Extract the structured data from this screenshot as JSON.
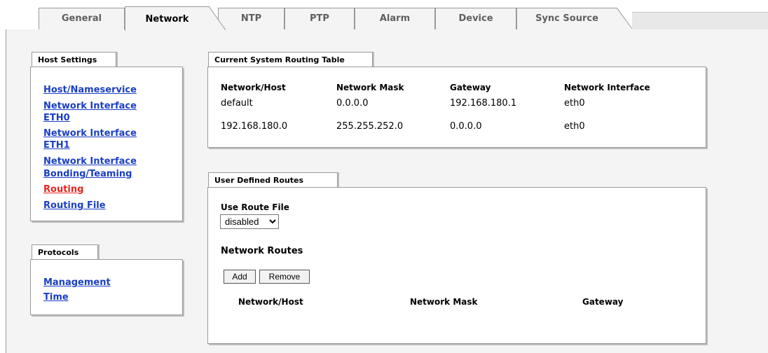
{
  "tabs": [
    {
      "label": "General"
    },
    {
      "label": "Network"
    },
    {
      "label": "NTP"
    },
    {
      "label": "PTP"
    },
    {
      "label": "Alarm"
    },
    {
      "label": "Device"
    },
    {
      "label": "Sync Source"
    }
  ],
  "host_settings": {
    "title": "Host Settings",
    "items": [
      {
        "label": "Host/Nameservice"
      },
      {
        "label": "Network Interface"
      },
      {
        "label": "ETH0"
      },
      {
        "label": "Network Interface"
      },
      {
        "label": "ETH1"
      },
      {
        "label": "Network Interface"
      },
      {
        "label": "Bonding/Teaming"
      },
      {
        "label": "Routing"
      },
      {
        "label": "Routing File"
      }
    ]
  },
  "protocols": {
    "title": "Protocols",
    "items": [
      {
        "label": "Management"
      },
      {
        "label": "Time"
      }
    ]
  },
  "routing_table": {
    "title": "Current System Routing Table",
    "headers": [
      "Network/Host",
      "Network Mask",
      "Gateway",
      "Network Interface"
    ],
    "rows": [
      [
        "default",
        "0.0.0.0",
        "192.168.180.1",
        "eth0"
      ],
      [
        "192.168.180.0",
        "255.255.252.0",
        "0.0.0.0",
        "eth0"
      ]
    ]
  },
  "user_routes": {
    "title": "User Defined Routes",
    "use_route_file_label": "Use Route File",
    "use_route_file_value": "disabled",
    "network_routes_label": "Network Routes",
    "add_label": "Add",
    "remove_label": "Remove",
    "headers": [
      "Network/Host",
      "Network Mask",
      "Gateway"
    ]
  }
}
